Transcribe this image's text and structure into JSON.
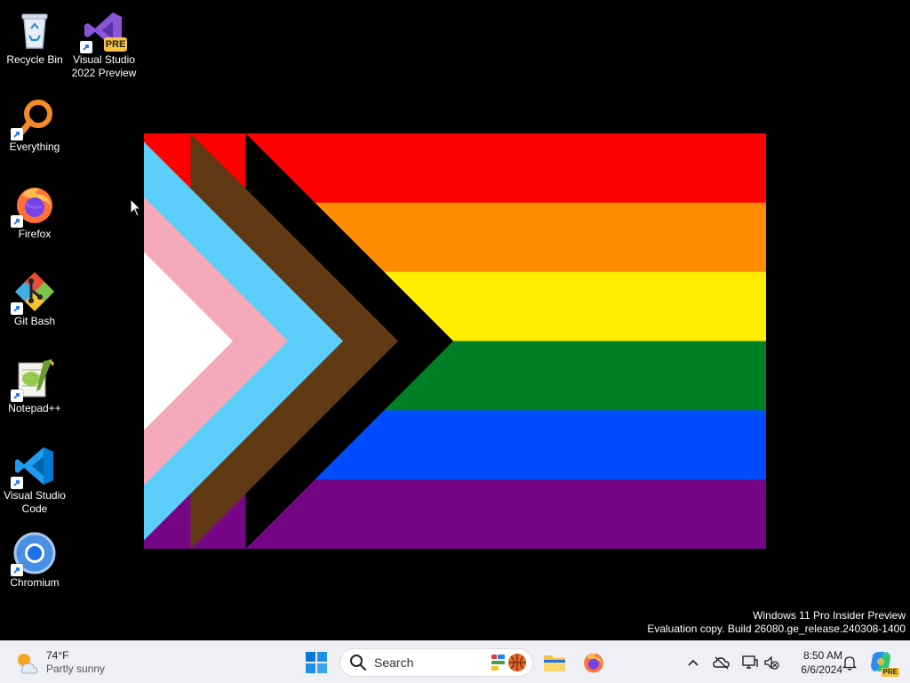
{
  "desktop": {
    "icons": [
      {
        "label": "Recycle Bin",
        "icon": "recycle-bin-icon"
      },
      {
        "label": "Visual Studio\n2022 Preview",
        "line1": "Visual Studio",
        "line2": "2022 Preview",
        "icon": "visual-studio-icon",
        "badge": "PRE"
      },
      {
        "label": "Everything",
        "icon": "everything-search-icon"
      },
      {
        "label": "Firefox",
        "icon": "firefox-icon"
      },
      {
        "label": "Git Bash",
        "icon": "git-bash-icon"
      },
      {
        "label": "Notepad++",
        "icon": "notepad-plus-plus-icon"
      },
      {
        "label": "Visual Studio Code",
        "line1": "Visual Studio",
        "line2": "Code",
        "icon": "vscode-icon"
      },
      {
        "label": "Chromium",
        "icon": "chromium-icon"
      }
    ],
    "wallpaper": {
      "stripe_colors": [
        "#FF0000",
        "#FF8C00",
        "#FFED00",
        "#008026",
        "#004DFF",
        "#750787"
      ],
      "chevron_colors": [
        "#000000",
        "#613915",
        "#5BCEFA",
        "#F5A9B8",
        "#FFFFFF"
      ]
    },
    "watermark": {
      "line1": "Windows 11 Pro Insider Preview",
      "line2": "Evaluation copy. Build 26080.ge_release.240308-1400"
    }
  },
  "taskbar": {
    "weather": {
      "temp": "74°F",
      "condition": "Partly sunny",
      "icon": "weather-partly-sunny-icon"
    },
    "start_icon": "windows-start-icon",
    "search": {
      "placeholder": "Search",
      "icon": "search-icon"
    },
    "widgets_icon": "widgets-basketball-icon",
    "pinned": [
      {
        "name": "file-explorer",
        "icon": "folder-icon"
      },
      {
        "name": "firefox",
        "icon": "firefox-icon"
      }
    ],
    "tray": {
      "chevron_icon": "chevron-up-icon",
      "icons": [
        "onedrive-offline-icon",
        "network-icon",
        "volume-muted-icon"
      ],
      "time": "8:50 AM",
      "date": "6/6/2024",
      "notification_icon": "bell-icon",
      "copilot_icon": "copilot-icon",
      "copilot_badge": "PRE"
    }
  },
  "colors": {
    "desktop_bg": "#000000",
    "taskbar_bg": "#EEF0F5",
    "accent": "#0078D4"
  }
}
